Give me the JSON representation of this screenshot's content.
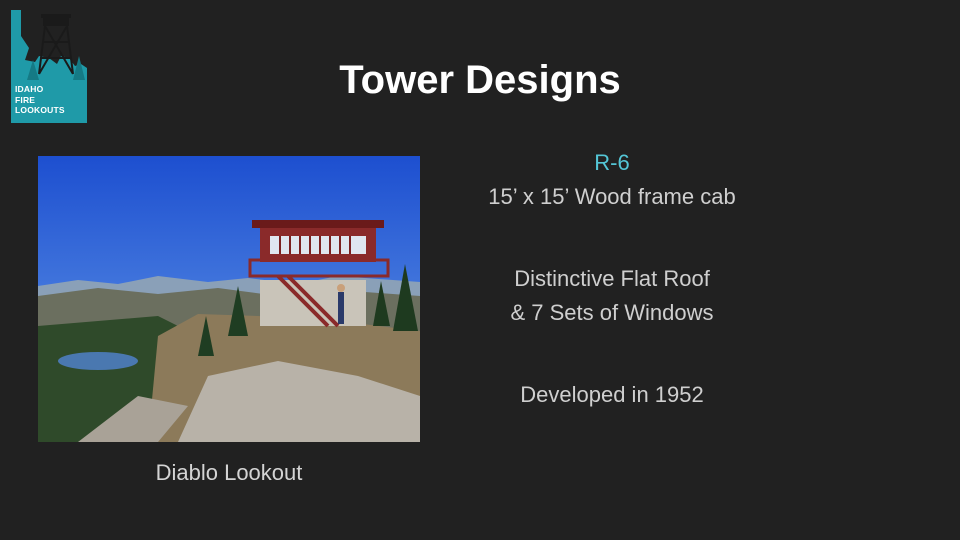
{
  "logo": {
    "lines": [
      "IDAHO",
      "FIRE",
      "LOOKOUTS"
    ],
    "color": "#1f9aa8"
  },
  "title": "Tower Designs",
  "photo": {
    "caption": "Diablo Lookout"
  },
  "details": {
    "model": "R-6",
    "size": "15’ x 15’ Wood frame cab",
    "feature_line1": "Distinctive Flat Roof",
    "feature_line2": "& 7 Sets of Windows",
    "developed": "Developed in 1952"
  },
  "colors": {
    "background": "#212121",
    "accent": "#54c6d6",
    "text": "#cfcfcf"
  }
}
